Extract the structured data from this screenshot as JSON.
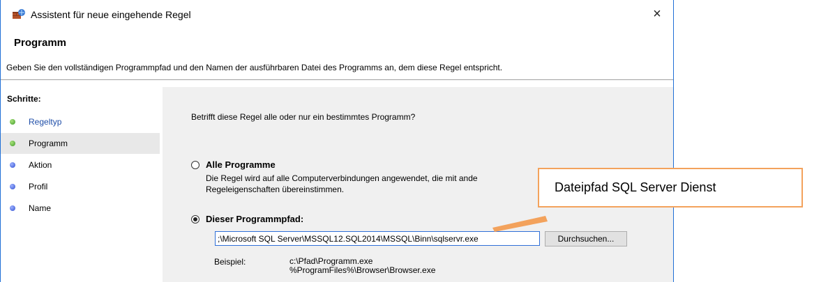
{
  "window": {
    "title": "Assistent für neue eingehende Regel",
    "close_symbol": "×"
  },
  "page": {
    "heading": "Programm",
    "description": "Geben Sie den vollständigen Programmpfad und den Namen der ausführbaren Datei des Programms an, dem diese Regel entspricht."
  },
  "steps": {
    "title": "Schritte:",
    "items": [
      {
        "label": "Regeltyp",
        "status": "done",
        "color": "#3f9a2a"
      },
      {
        "label": "Programm",
        "status": "current",
        "color": "#3f9a2a"
      },
      {
        "label": "Aktion",
        "status": "pending",
        "color": "#2f4fd0"
      },
      {
        "label": "Profil",
        "status": "pending",
        "color": "#2f4fd0"
      },
      {
        "label": "Name",
        "status": "pending",
        "color": "#2f4fd0"
      }
    ]
  },
  "content": {
    "question": "Betrifft diese Regel alle oder nur ein bestimmtes Programm?",
    "option_all": {
      "label": "Alle Programme",
      "desc_line1": "Die Regel wird auf alle Computerverbindungen angewendet, die mit ande",
      "desc_line2": "Regeleigenschaften übereinstimmen.",
      "selected": false
    },
    "option_path": {
      "label": "Dieser Programmpfad:",
      "selected": true,
      "value": ";\\Microsoft SQL Server\\MSSQL12.SQL2014\\MSSQL\\Binn\\sqlservr.exe"
    },
    "browse_label": "Durchsuchen...",
    "example_label": "Beispiel:",
    "example_line1": "c:\\Pfad\\Programm.exe",
    "example_line2": "%ProgramFiles%\\Browser\\Browser.exe"
  },
  "callout": {
    "text": "Dateipfad SQL Server Dienst",
    "color": "#f3a25c"
  }
}
